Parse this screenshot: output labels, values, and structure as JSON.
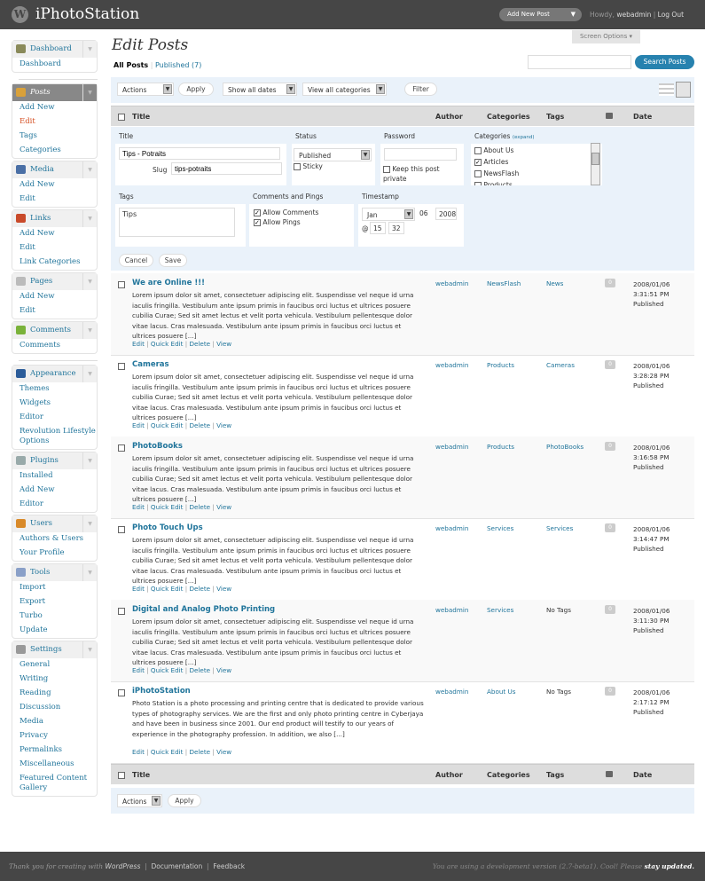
{
  "header": {
    "site_title": "iPhotoStation",
    "add_new_post": "Add New Post",
    "howdy": "Howdy, ",
    "user": "webadmin",
    "log_out": "Log Out",
    "screen_options": "Screen Options"
  },
  "sidebar": {
    "groups": [
      {
        "label": "Dashboard",
        "icon": "dashboard-icon",
        "color": "#8a8a5a",
        "items": [
          "Dashboard"
        ]
      },
      {
        "sep": true
      },
      {
        "label": "Posts",
        "icon": "posts-icon",
        "color": "#d9a13a",
        "current": true,
        "items": [
          "Add New",
          "Edit",
          "Tags",
          "Categories"
        ],
        "current_item": "Edit"
      },
      {
        "label": "Media",
        "icon": "media-icon",
        "color": "#4a6fa5",
        "items": [
          "Add New",
          "Edit"
        ]
      },
      {
        "label": "Links",
        "icon": "links-icon",
        "color": "#c94a2a",
        "items": [
          "Add New",
          "Edit",
          "Link Categories"
        ]
      },
      {
        "label": "Pages",
        "icon": "pages-icon",
        "color": "#bbb",
        "items": [
          "Add New",
          "Edit"
        ]
      },
      {
        "label": "Comments",
        "icon": "comments-icon",
        "color": "#7ab23a",
        "items": [
          "Comments"
        ]
      },
      {
        "sep": true
      },
      {
        "label": "Appearance",
        "icon": "appearance-icon",
        "color": "#2c5d9a",
        "items": [
          "Themes",
          "Widgets",
          "Editor",
          "Revolution Lifestyle Options"
        ]
      },
      {
        "label": "Plugins",
        "icon": "plugins-icon",
        "color": "#9aa",
        "items": [
          "Installed",
          "Add New",
          "Editor"
        ]
      },
      {
        "label": "Users",
        "icon": "users-icon",
        "color": "#d98a2a",
        "items": [
          "Authors & Users",
          "Your Profile"
        ]
      },
      {
        "label": "Tools",
        "icon": "tools-icon",
        "color": "#8aa0c8",
        "items": [
          "Import",
          "Export",
          "Turbo",
          "Update"
        ]
      },
      {
        "label": "Settings",
        "icon": "settings-icon",
        "color": "#999",
        "items": [
          "General",
          "Writing",
          "Reading",
          "Discussion",
          "Media",
          "Privacy",
          "Permalinks",
          "Miscellaneous",
          "Featured Content Gallery"
        ]
      }
    ]
  },
  "page": {
    "title": "Edit Posts",
    "all_posts": "All Posts",
    "published": "Published (7)",
    "search_button": "Search Posts",
    "search_value": ""
  },
  "nav": {
    "actions": "Actions",
    "apply": "Apply",
    "dates": "Show all dates",
    "categories": "View all categories",
    "filter": "Filter"
  },
  "columns": {
    "title": "Title",
    "author": "Author",
    "categories": "Categories",
    "tags": "Tags",
    "date": "Date"
  },
  "quick_edit": {
    "title_label": "Title",
    "title_value": "Tips - Potraits",
    "slug_label": "Slug",
    "slug_value": "tips-potraits",
    "status_label": "Status",
    "status_value": "Published",
    "sticky": "Sticky",
    "password_label": "Password",
    "private": "Keep this post private",
    "categories_label": "Categories",
    "expand": "(expand)",
    "cats": [
      {
        "name": "About Us",
        "checked": false
      },
      {
        "name": "Articles",
        "checked": true
      },
      {
        "name": "NewsFlash",
        "checked": false
      },
      {
        "name": "Products",
        "checked": false
      }
    ],
    "tags_label": "Tags",
    "tags_value": "Tips",
    "comments_label": "Comments and Pings",
    "allow_comments": "Allow Comments",
    "allow_pings": "Allow Pings",
    "timestamp_label": "Timestamp",
    "month": "Jan",
    "day": "06",
    "year": "2008",
    "at": "@",
    "hour": "15",
    "minute": "32",
    "cancel": "Cancel",
    "save": "Save"
  },
  "row_actions": {
    "edit": "Edit",
    "quick_edit": "Quick Edit",
    "delete": "Delete",
    "view": "View"
  },
  "posts": [
    {
      "title": "We are Online !!!",
      "excerpt": "Lorem ipsum dolor sit amet, consectetuer adipiscing elit. Suspendisse vel neque id urna iaculis fringilla. Vestibulum ante ipsum primis in faucibus orci luctus et ultrices posuere cubilia Curae; Sed sit amet lectus et velit porta vehicula. Vestibulum pellentesque dolor vitae lacus. Cras malesuada. Vestibulum ante ipsum primis in faucibus orci luctus et ultrices posuere [...]",
      "author": "webadmin",
      "category": "NewsFlash",
      "tags": "News",
      "comments": "0",
      "date": "2008/01/06",
      "time": "3:31:51 PM",
      "status": "Published"
    },
    {
      "title": "Cameras",
      "excerpt": "Lorem ipsum dolor sit amet, consectetuer adipiscing elit. Suspendisse vel neque id urna iaculis fringilla. Vestibulum ante ipsum primis in faucibus orci luctus et ultrices posuere cubilia Curae; Sed sit amet lectus et velit porta vehicula. Vestibulum pellentesque dolor vitae lacus. Cras malesuada. Vestibulum ante ipsum primis in faucibus orci luctus et ultrices posuere [...]",
      "author": "webadmin",
      "category": "Products",
      "tags": "Cameras",
      "comments": "0",
      "date": "2008/01/06",
      "time": "3:28:28 PM",
      "status": "Published"
    },
    {
      "title": "PhotoBooks",
      "excerpt": "Lorem ipsum dolor sit amet, consectetuer adipiscing elit. Suspendisse vel neque id urna iaculis fringilla. Vestibulum ante ipsum primis in faucibus orci luctus et ultrices posuere cubilia Curae; Sed sit amet lectus et velit porta vehicula. Vestibulum pellentesque dolor vitae lacus. Cras malesuada. Vestibulum ante ipsum primis in faucibus orci luctus et ultrices posuere [...]",
      "author": "webadmin",
      "category": "Products",
      "tags": "PhotoBooks",
      "comments": "0",
      "date": "2008/01/06",
      "time": "3:16:58 PM",
      "status": "Published"
    },
    {
      "title": "Photo Touch Ups",
      "excerpt": "Lorem ipsum dolor sit amet, consectetuer adipiscing elit. Suspendisse vel neque id urna iaculis fringilla. Vestibulum ante ipsum primis in faucibus orci luctus et ultrices posuere cubilia Curae; Sed sit amet lectus et velit porta vehicula. Vestibulum pellentesque dolor vitae lacus. Cras malesuada. Vestibulum ante ipsum primis in faucibus orci luctus et ultrices posuere [...]",
      "author": "webadmin",
      "category": "Services",
      "tags": "Services",
      "comments": "0",
      "date": "2008/01/06",
      "time": "3:14:47 PM",
      "status": "Published"
    },
    {
      "title": "Digital and Analog Photo Printing",
      "excerpt": "Lorem ipsum dolor sit amet, consectetuer adipiscing elit. Suspendisse vel neque id urna iaculis fringilla. Vestibulum ante ipsum primis in faucibus orci luctus et ultrices posuere cubilia Curae; Sed sit amet lectus et velit porta vehicula. Vestibulum pellentesque dolor vitae lacus. Cras malesuada. Vestibulum ante ipsum primis in faucibus orci luctus et ultrices posuere [...]",
      "author": "webadmin",
      "category": "Services",
      "tags": "No Tags",
      "comments": "0",
      "date": "2008/01/06",
      "time": "3:11:30 PM",
      "status": "Published"
    },
    {
      "title": "iPhotoStation",
      "excerpt": "Photo Station is a photo processing and printing centre that is dedicated to provide various types of photography services. We are the first and only photo printing centre in Cyberjaya and have been in business since 2001. Our end product will testify to our years of experience in the photography profession. In addition, we also [...]",
      "author": "webadmin",
      "category": "About Us",
      "tags": "No Tags",
      "comments": "0",
      "date": "2008/01/06",
      "time": "2:17:12 PM",
      "status": "Published"
    }
  ],
  "footer": {
    "thanks": "Thank you for creating with ",
    "wordpress": "WordPress",
    "documentation": "Documentation",
    "feedback": "Feedback",
    "dev_notice": "You are using a development version (2.7-beta1). Cool! Please ",
    "stay_updated": "stay updated."
  }
}
